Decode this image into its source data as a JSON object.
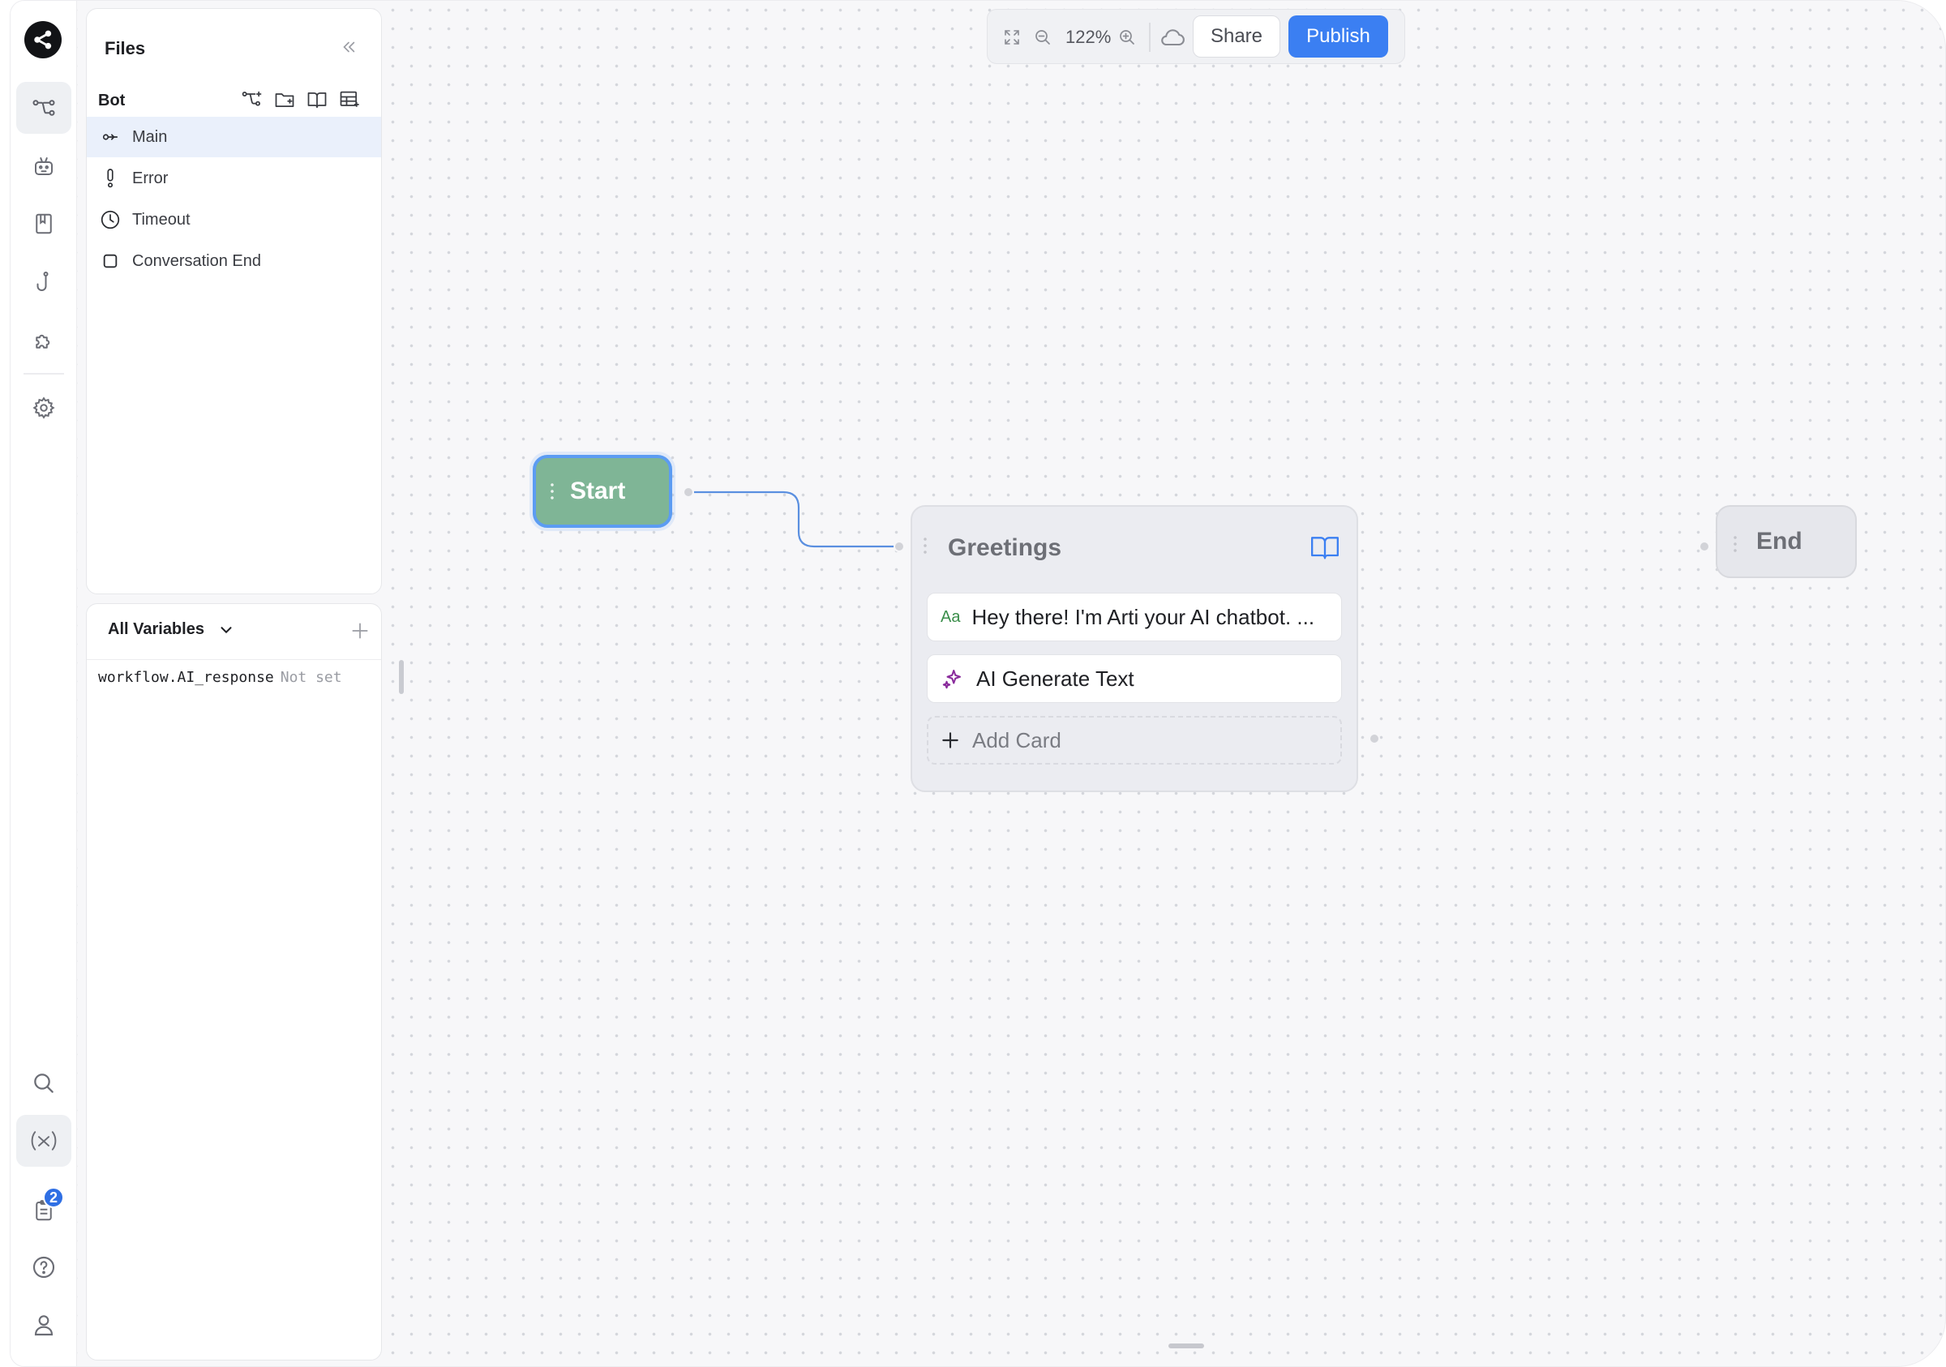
{
  "toolbar": {
    "zoom": "122%",
    "share_label": "Share",
    "publish_label": "Publish"
  },
  "rail": {
    "items": [
      {
        "icon": "workflow-icon",
        "active": true
      },
      {
        "icon": "robot-icon"
      },
      {
        "icon": "book-icon"
      },
      {
        "icon": "hook-icon"
      },
      {
        "icon": "puzzle-icon"
      },
      {
        "icon": "gear-icon"
      }
    ],
    "bottom_items": [
      {
        "icon": "search-icon"
      },
      {
        "icon": "variable-icon",
        "active": true
      },
      {
        "icon": "clipboard-icon"
      },
      {
        "icon": "help-icon"
      },
      {
        "icon": "user-icon"
      }
    ],
    "notification_count": "2"
  },
  "files": {
    "title": "Files",
    "bot_label": "Bot",
    "items": [
      {
        "label": "Main",
        "icon": "key-icon",
        "selected": true
      },
      {
        "label": "Error",
        "icon": "exclamation-icon"
      },
      {
        "label": "Timeout",
        "icon": "clock-icon"
      },
      {
        "label": "Conversation End",
        "icon": "square-icon"
      }
    ]
  },
  "variables": {
    "filter_label": "All Variables",
    "rows": [
      {
        "name": "workflow.AI_response",
        "value": "Not set"
      }
    ]
  },
  "canvas": {
    "start_label": "Start",
    "end_label": "End",
    "block": {
      "title": "Greetings",
      "cards": [
        {
          "icon_text": "Aa",
          "label": "Hey there! I'm Arti your AI chatbot. ..."
        },
        {
          "icon": "sparkle-icon",
          "label": "AI Generate Text"
        }
      ],
      "add_card_label": "Add Card"
    }
  },
  "colors": {
    "accent": "#3b7ff2",
    "start_node": "#7fb596",
    "selected_row": "#eaf0fb"
  }
}
